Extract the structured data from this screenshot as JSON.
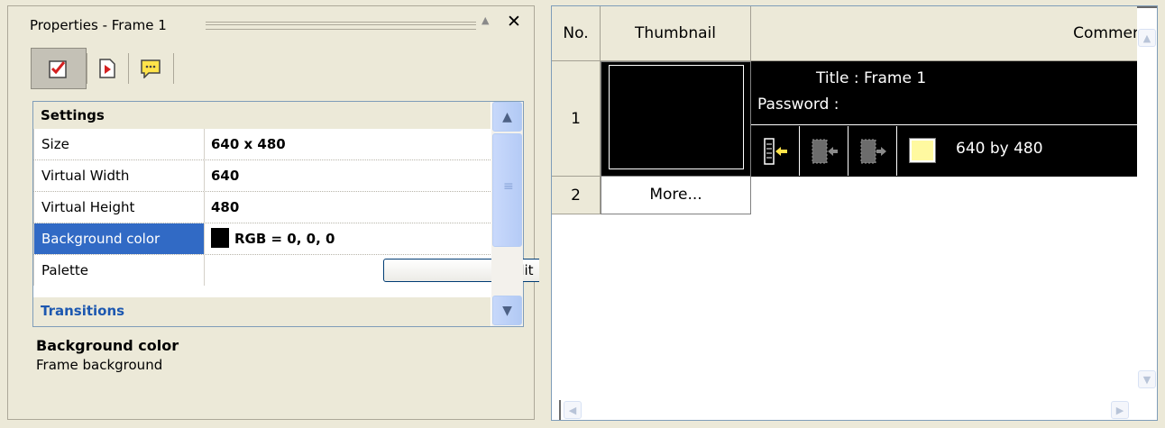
{
  "properties_panel": {
    "title": "Properties - Frame 1",
    "pin_glyph": "▲",
    "close_glyph": "✕",
    "toolbar": [
      {
        "name": "settings-tab",
        "icon": "checklist-icon",
        "active": true
      },
      {
        "name": "transitions-tab",
        "icon": "play-page-icon",
        "active": false
      },
      {
        "name": "comments-tab",
        "icon": "speech-note-icon",
        "active": false
      }
    ],
    "categories": {
      "settings": "Settings",
      "transitions": "Transitions"
    },
    "properties": [
      {
        "name": "Size",
        "value": "640 x 480"
      },
      {
        "name": "Virtual Width",
        "value": "640"
      },
      {
        "name": "Virtual Height",
        "value": "480"
      },
      {
        "name": "Background color",
        "value": "RGB = 0, 0, 0",
        "selected": true,
        "swatch": "#000000"
      },
      {
        "name": "Palette",
        "value": "Edit"
      }
    ],
    "description": {
      "title": "Background color",
      "text": "Frame background"
    },
    "scroll_glyphs": {
      "up": "▲",
      "down": "▼"
    }
  },
  "frame_list": {
    "columns": {
      "no": "No.",
      "thumbnail": "Thumbnail",
      "comment": "Commer"
    },
    "rows": [
      {
        "number": "1",
        "title": "Title : Frame 1",
        "password": "Password :",
        "size_text": "640 by 480",
        "color_chip": "#fff9a0"
      },
      {
        "number": "2",
        "thumbnail_text": "More..."
      }
    ],
    "scroll_glyphs": {
      "up": "▲",
      "down": "▼",
      "left": "◀",
      "right": "▶"
    }
  },
  "colors": {
    "selection": "#316ac5",
    "panel": "#ece9d8",
    "category_link": "#1d58b0"
  }
}
